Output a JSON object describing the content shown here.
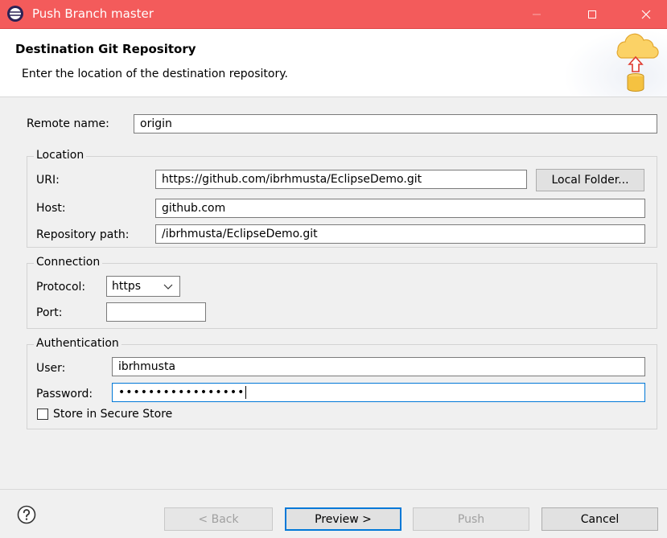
{
  "window": {
    "title": "Push Branch master"
  },
  "header": {
    "heading": "Destination Git Repository",
    "description": "Enter the location of the destination repository."
  },
  "remote": {
    "label": "Remote name:",
    "value": "origin"
  },
  "location": {
    "group_title": "Location",
    "uri_label": "URI:",
    "uri_value": "https://github.com/ibrhmusta/EclipseDemo.git",
    "local_folder_button": "Local Folder...",
    "host_label": "Host:",
    "host_value": "github.com",
    "repo_path_label": "Repository path:",
    "repo_path_value": "/ibrhmusta/EclipseDemo.git"
  },
  "connection": {
    "group_title": "Connection",
    "protocol_label": "Protocol:",
    "protocol_value": "https",
    "port_label": "Port:",
    "port_value": ""
  },
  "authentication": {
    "group_title": "Authentication",
    "user_label": "User:",
    "user_value": "ibrhmusta",
    "password_label": "Password:",
    "password_value": "•••••••••••••••••",
    "store_label": "Store in Secure Store",
    "store_checked": false
  },
  "footer": {
    "back_label": "< Back",
    "preview_label": "Preview >",
    "push_label": "Push",
    "cancel_label": "Cancel"
  },
  "colors": {
    "titlebar": "#f35b5b",
    "focus_border": "#0078d7"
  }
}
